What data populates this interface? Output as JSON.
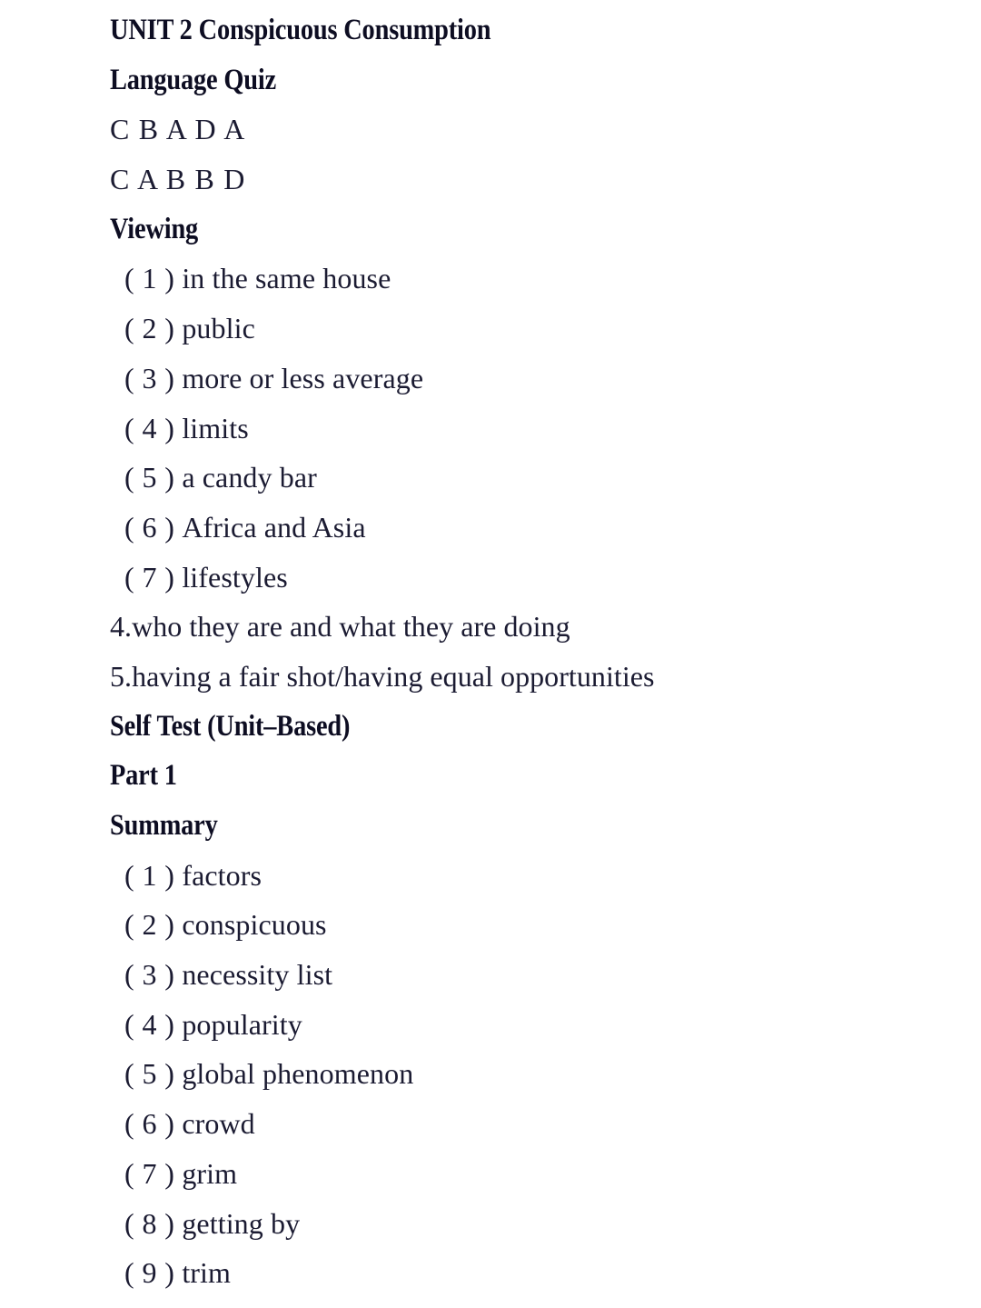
{
  "document": {
    "title": "UNIT 2 Conspicuous Consumption",
    "sections": [
      {
        "kind": "heading",
        "text": "UNIT 2 Conspicuous Consumption"
      },
      {
        "kind": "heading",
        "text": "Language Quiz"
      },
      {
        "kind": "letters",
        "text": "C B A D A"
      },
      {
        "kind": "letters",
        "text": "C A B B D"
      },
      {
        "kind": "heading",
        "text": "Viewing"
      },
      {
        "kind": "item",
        "num": "( 1 )",
        "text": "in the same house"
      },
      {
        "kind": "item",
        "num": "( 2 )",
        "text": "public"
      },
      {
        "kind": "item",
        "num": "( 3 )",
        "text": "more or less average"
      },
      {
        "kind": "item",
        "num": "( 4 )",
        "text": "limits"
      },
      {
        "kind": "item",
        "num": "( 5 )",
        "text": "a candy bar"
      },
      {
        "kind": "item",
        "num": "( 6 )",
        "text": "Africa and Asia"
      },
      {
        "kind": "item",
        "num": "( 7 )",
        "text": "lifestyles"
      },
      {
        "kind": "numbered",
        "text": "4.who they are and what they are doing"
      },
      {
        "kind": "numbered",
        "text": "5.having a fair shot/having equal opportunities"
      },
      {
        "kind": "heading",
        "text": "Self Test (Unit–Based)"
      },
      {
        "kind": "heading",
        "text": "Part 1"
      },
      {
        "kind": "heading",
        "text": "Summary"
      },
      {
        "kind": "item",
        "num": "( 1 )",
        "text": "factors"
      },
      {
        "kind": "item",
        "num": "( 2 )",
        "text": "conspicuous"
      },
      {
        "kind": "item",
        "num": "( 3 )",
        "text": "necessity list"
      },
      {
        "kind": "item",
        "num": "( 4 )",
        "text": "popularity"
      },
      {
        "kind": "item",
        "num": "( 5 )",
        "text": "global phenomenon"
      },
      {
        "kind": "item",
        "num": "( 6 )",
        "text": "crowd"
      },
      {
        "kind": "item",
        "num": "( 7 )",
        "text": "grim"
      },
      {
        "kind": "item",
        "num": "( 8 )",
        "text": "getting by"
      },
      {
        "kind": "item",
        "num": "( 9 )",
        "text": "trim"
      }
    ]
  },
  "style": {
    "page_background": "#ffffff",
    "text_color": "#1b1b32",
    "heading_color": "#0d0d22"
  }
}
